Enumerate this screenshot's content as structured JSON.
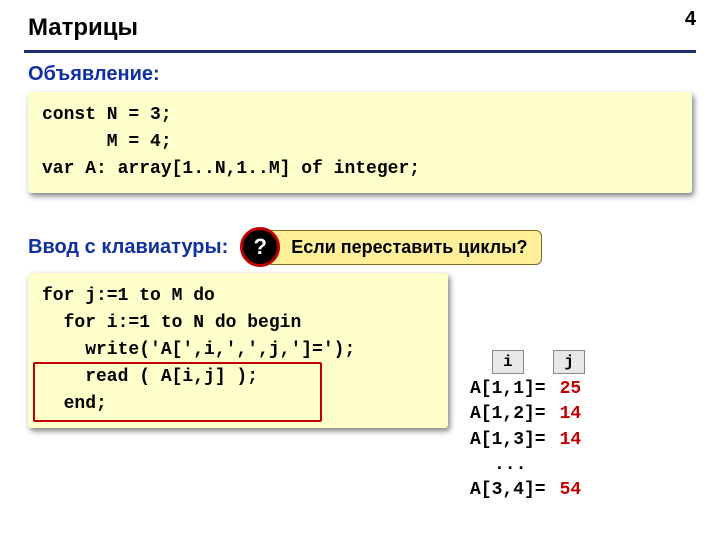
{
  "pageNumber": "4",
  "title": "Матрицы",
  "declaration": {
    "heading": "Объявление:",
    "code": "const N = 3;\n      M = 4;\nvar A: array[1..N,1..M] of integer;"
  },
  "input": {
    "heading": "Ввод с клавиатуры:",
    "question": "Если переставить циклы?",
    "qmark": "?",
    "code": "for j:=1 to M do\n  for i:=1 to N do begin\n    write('A[',i,',',j,']=');\n    read ( A[i,j] );\n  end;"
  },
  "labels": {
    "i": "i",
    "j": "j"
  },
  "sample": [
    {
      "label": "A[1,1]=",
      "value": "25"
    },
    {
      "label": "A[1,2]=",
      "value": "14"
    },
    {
      "label": "A[1,3]=",
      "value": "14"
    },
    {
      "label": "...",
      "value": ""
    },
    {
      "label": "A[3,4]=",
      "value": "54"
    }
  ]
}
